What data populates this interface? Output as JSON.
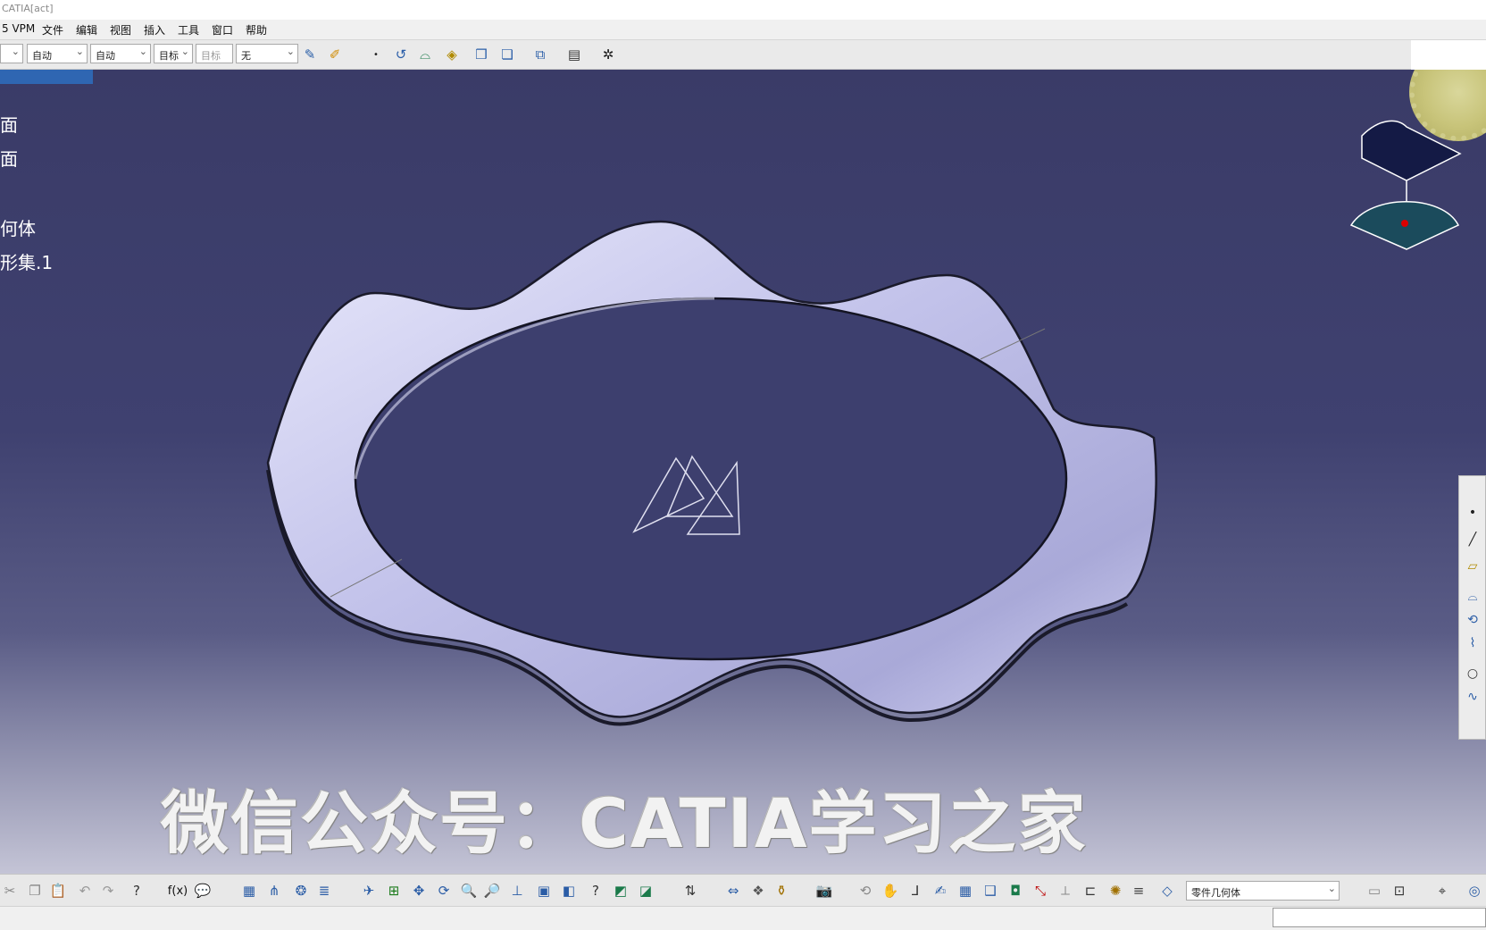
{
  "window": {
    "title": "CATIA[act]"
  },
  "menu": {
    "items": [
      "5 VPM",
      "文件",
      "编辑",
      "视图",
      "插入",
      "工具",
      "窗口",
      "帮助"
    ]
  },
  "toolbar": {
    "combos": [
      "",
      "自动",
      "自动",
      "目标",
      "目标",
      "无"
    ]
  },
  "tree": {
    "items": [
      "面",
      "面",
      "何体",
      "形集.1"
    ]
  },
  "bottom": {
    "workbench_combo": "零件几何体"
  },
  "watermark": {
    "text_cn1": "微信公众号：",
    "text_en": "CATIA",
    "text_cn2": "学习之家"
  },
  "icons": [
    "sketch-icon",
    "measure-icon",
    "point-icon",
    "line-icon",
    "plane-icon",
    "compass-icon",
    "formula-icon",
    "zoom-in-icon",
    "zoom-out-icon",
    "pan-icon",
    "rotate-icon",
    "fit-all-icon"
  ],
  "colors": {
    "background_top": "#3a3b67",
    "background_bottom": "#c4c4d6",
    "model": "#c9c9f0",
    "watermark": "#f2f2f2"
  }
}
